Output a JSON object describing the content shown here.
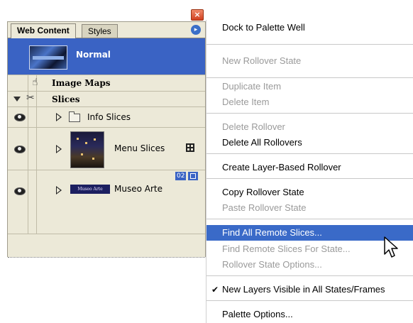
{
  "palette": {
    "close_glyph": "×",
    "tabs": [
      {
        "label": "Web Content",
        "active": true
      },
      {
        "label": "Styles",
        "active": false
      }
    ],
    "menu_glyph": "▸",
    "rows": {
      "normal": {
        "label": "Normal"
      },
      "image_maps": {
        "label": "Image Maps"
      },
      "slices": {
        "label": "Slices"
      },
      "info_slices": {
        "label": "Info Slices"
      },
      "menu_slices": {
        "label": "Menu Slices"
      },
      "museo_arte": {
        "label": "Museo Arte",
        "badge": "02",
        "thumb_text": "Museo Arte"
      }
    },
    "colors": {
      "selection": "#3a63c4",
      "panel_bg": "#ece9d8"
    }
  },
  "context_menu": {
    "items": [
      {
        "label": "Dock to Palette Well",
        "state": "enabled"
      },
      {
        "label": "New Rollover State",
        "state": "disabled"
      },
      {
        "label": "Duplicate Item",
        "state": "disabled"
      },
      {
        "label": "Delete Item",
        "state": "disabled"
      },
      {
        "label": "Delete Rollover",
        "state": "disabled"
      },
      {
        "label": "Delete All Rollovers",
        "state": "enabled"
      },
      {
        "label": "Create Layer-Based Rollover",
        "state": "enabled"
      },
      {
        "label": "Copy Rollover State",
        "state": "enabled"
      },
      {
        "label": "Paste Rollover State",
        "state": "disabled"
      },
      {
        "label": "Find All Remote Slices...",
        "state": "highlighted"
      },
      {
        "label": "Find Remote Slices For State...",
        "state": "disabled"
      },
      {
        "label": "Rollover State Options...",
        "state": "disabled"
      },
      {
        "label": "New Layers Visible in All States/Frames",
        "state": "checked"
      },
      {
        "label": "Palette Options...",
        "state": "enabled"
      }
    ],
    "check_glyph": "✔",
    "highlight_color": "#3a6ac8"
  }
}
